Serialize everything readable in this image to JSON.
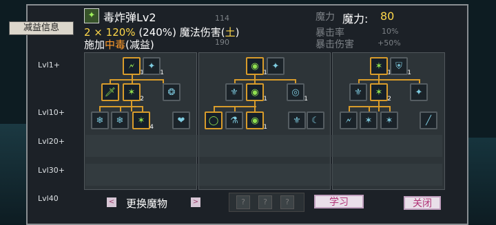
{
  "header": {
    "skill_name": "毒炸弹Lv2",
    "line2_prefix": "2 × ",
    "line2_percent": "120%",
    "line2_total": "(240%)",
    "line2_type": "魔法伤害(",
    "line2_element": "土",
    "line2_close": ")",
    "line3_prefix": "施加",
    "line3_effect": "中毒",
    "line3_suffix": "(减益)",
    "mana_label": "魔力:",
    "mana_value": "80",
    "crit_rate_label": "暴击率",
    "crit_rate_value": "10%",
    "crit_dmg_label": "暴击伤害",
    "crit_dmg_value": "+50%",
    "bg_mana_label": "魔力",
    "bg_value_1": "114",
    "bg_value_2": "190"
  },
  "debuff_button": "减益信息",
  "rows": [
    "Lvl1+",
    "Lvl10+",
    "Lvl20+",
    "Lvl30+",
    "Lvl40"
  ],
  "tree_a": {
    "r1": [
      {
        "lv": "1",
        "icon": "🗲"
      },
      {
        "lv": "1",
        "icon": "✦"
      }
    ],
    "r2": [
      {
        "lv": "",
        "icon": "🗡"
      },
      {
        "lv": "2",
        "icon": "✶"
      },
      {
        "lv": "",
        "icon": "❂"
      }
    ],
    "r3": [
      {
        "lv": "",
        "icon": "❄"
      },
      {
        "lv": "",
        "icon": "❄"
      },
      {
        "lv": "4",
        "icon": "✶"
      },
      {
        "lv": "",
        "icon": "❤"
      }
    ]
  },
  "tree_b": {
    "r1": [
      {
        "lv": "1",
        "icon": "◉"
      },
      {
        "lv": "",
        "icon": "✦"
      }
    ],
    "r2": [
      {
        "lv": "",
        "icon": "⚜"
      },
      {
        "lv": "",
        "icon": "⚜"
      },
      {
        "lv": "1",
        "icon": "◉"
      },
      {
        "lv": "1",
        "icon": "◎"
      }
    ],
    "r3": [
      {
        "lv": "",
        "icon": "◯"
      },
      {
        "lv": "",
        "icon": "⚗"
      },
      {
        "lv": "1",
        "icon": "◉"
      },
      {
        "lv": "",
        "icon": "⚜"
      },
      {
        "lv": "",
        "icon": "☾"
      }
    ]
  },
  "tree_c": {
    "r1": [
      {
        "lv": "1",
        "icon": "✶"
      },
      {
        "lv": "1",
        "icon": "⛨"
      }
    ],
    "r2": [
      {
        "lv": "",
        "icon": "⚜"
      },
      {
        "lv": "2",
        "icon": "✶"
      },
      {
        "lv": "",
        "icon": "✦"
      }
    ],
    "r3": [
      {
        "lv": "",
        "icon": "🗲"
      },
      {
        "lv": "",
        "icon": "✶"
      },
      {
        "lv": "",
        "icon": "✶"
      },
      {
        "lv": "",
        "icon": "╱"
      }
    ]
  },
  "bottom": {
    "swap_label": "更换魔物",
    "prev_arrow": "<",
    "next_arrow": ">",
    "learn_label": "学习",
    "close_label": "关闭",
    "slot_mark": "?"
  },
  "colors": {
    "selected_border": "#d99c2b",
    "accent_yellow": "#ffd84a",
    "accent_orange": "#ff9b2a",
    "panel": "#1c2127"
  }
}
